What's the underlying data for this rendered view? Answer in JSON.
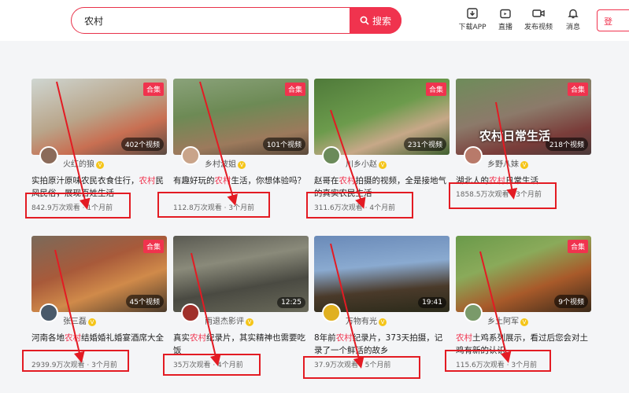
{
  "header": {
    "search_value": "农村",
    "search_button": "搜索",
    "nav": [
      {
        "label": "下载APP",
        "icon": "download-icon"
      },
      {
        "label": "直播",
        "icon": "tv-icon"
      },
      {
        "label": "发布视频",
        "icon": "camera-icon"
      },
      {
        "label": "消息",
        "icon": "bell-icon"
      }
    ],
    "login": "登"
  },
  "colors": {
    "accent": "#f0334e",
    "annotation": "#e31b23"
  },
  "cards": [
    {
      "badge": "合集",
      "count": "402个视频",
      "author": "火红的狼",
      "title_pre": "实拍原汁原味农民衣食住行，",
      "title_hl": "农村",
      "title_post": "民风民俗，展现百姓生活",
      "views": "842.9万次观看",
      "time": "1个月前"
    },
    {
      "badge": "合集",
      "count": "101个视频",
      "author": "乡村波姐",
      "title_pre": "有趣好玩的",
      "title_hl": "农村",
      "title_post": "生活，你想体验吗？",
      "views": "112.8万次观看",
      "time": "3个月前"
    },
    {
      "badge": "合集",
      "count": "231个视频",
      "author": "川乡小赵",
      "title_pre": "赵哥在",
      "title_hl": "农村",
      "title_post": "拍摄的视频，全是接地气的真实农民生活",
      "views": "311.6万次观看",
      "time": "4个月前"
    },
    {
      "badge": "合集",
      "count": "218个视频",
      "overlay": "农村日常生活",
      "author": "乡野八妹",
      "title_pre": "湖北人的",
      "title_hl": "农村",
      "title_post": "日常生活",
      "views": "1858.5万次观看",
      "time": "3个月前"
    },
    {
      "badge": "合集",
      "count": "45个视频",
      "author": "张三磊",
      "title_pre": "河南各地",
      "title_hl": "农村",
      "title_post": "结婚婚礼婚宴酒席大全",
      "views": "2939.9万次观看",
      "time": "3个月前"
    },
    {
      "badge": "",
      "count": "12:25",
      "author": "雨退杰影评",
      "title_pre": "真实",
      "title_hl": "农村",
      "title_post": "纪录片，其实精神也需要吃饭",
      "views": "35万次观看",
      "time": "4个月前"
    },
    {
      "badge": "",
      "count": "19:41",
      "author": "万物有光",
      "title_pre": "8年前",
      "title_hl": "农村",
      "title_post": "纪录片，373天拍摄，记录了一个鲜活的故乡",
      "views": "37.9万次观看",
      "time": "5个月前"
    },
    {
      "badge": "合集",
      "count": "9个视频",
      "author": "乡土阿军",
      "title_pre": "",
      "title_hl": "农村",
      "title_post": "土鸡系列展示，看过后您会对土鸡有新的认识",
      "views": "115.6万次观看",
      "time": "3个月前"
    }
  ]
}
